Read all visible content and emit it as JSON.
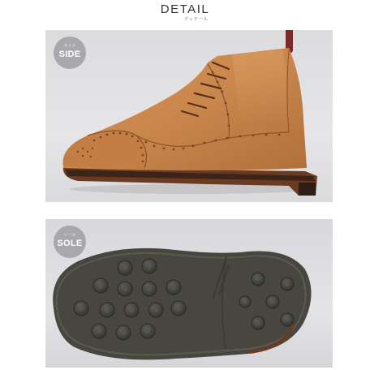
{
  "header": {
    "title": "DETAIL",
    "subtitle": "ディテール"
  },
  "panels": [
    {
      "id": "side",
      "badge_sub": "サイド",
      "badge_label": "SIDE"
    },
    {
      "id": "sole",
      "badge_sub": "ソール",
      "badge_label": "SOLE"
    }
  ],
  "colors": {
    "panel_bg": "#e3e3e6",
    "badge_bg": "#96969b",
    "boot_leather": "#c8854a",
    "welt": "#6b3a22",
    "sole_rubber": "#4a4a40"
  }
}
